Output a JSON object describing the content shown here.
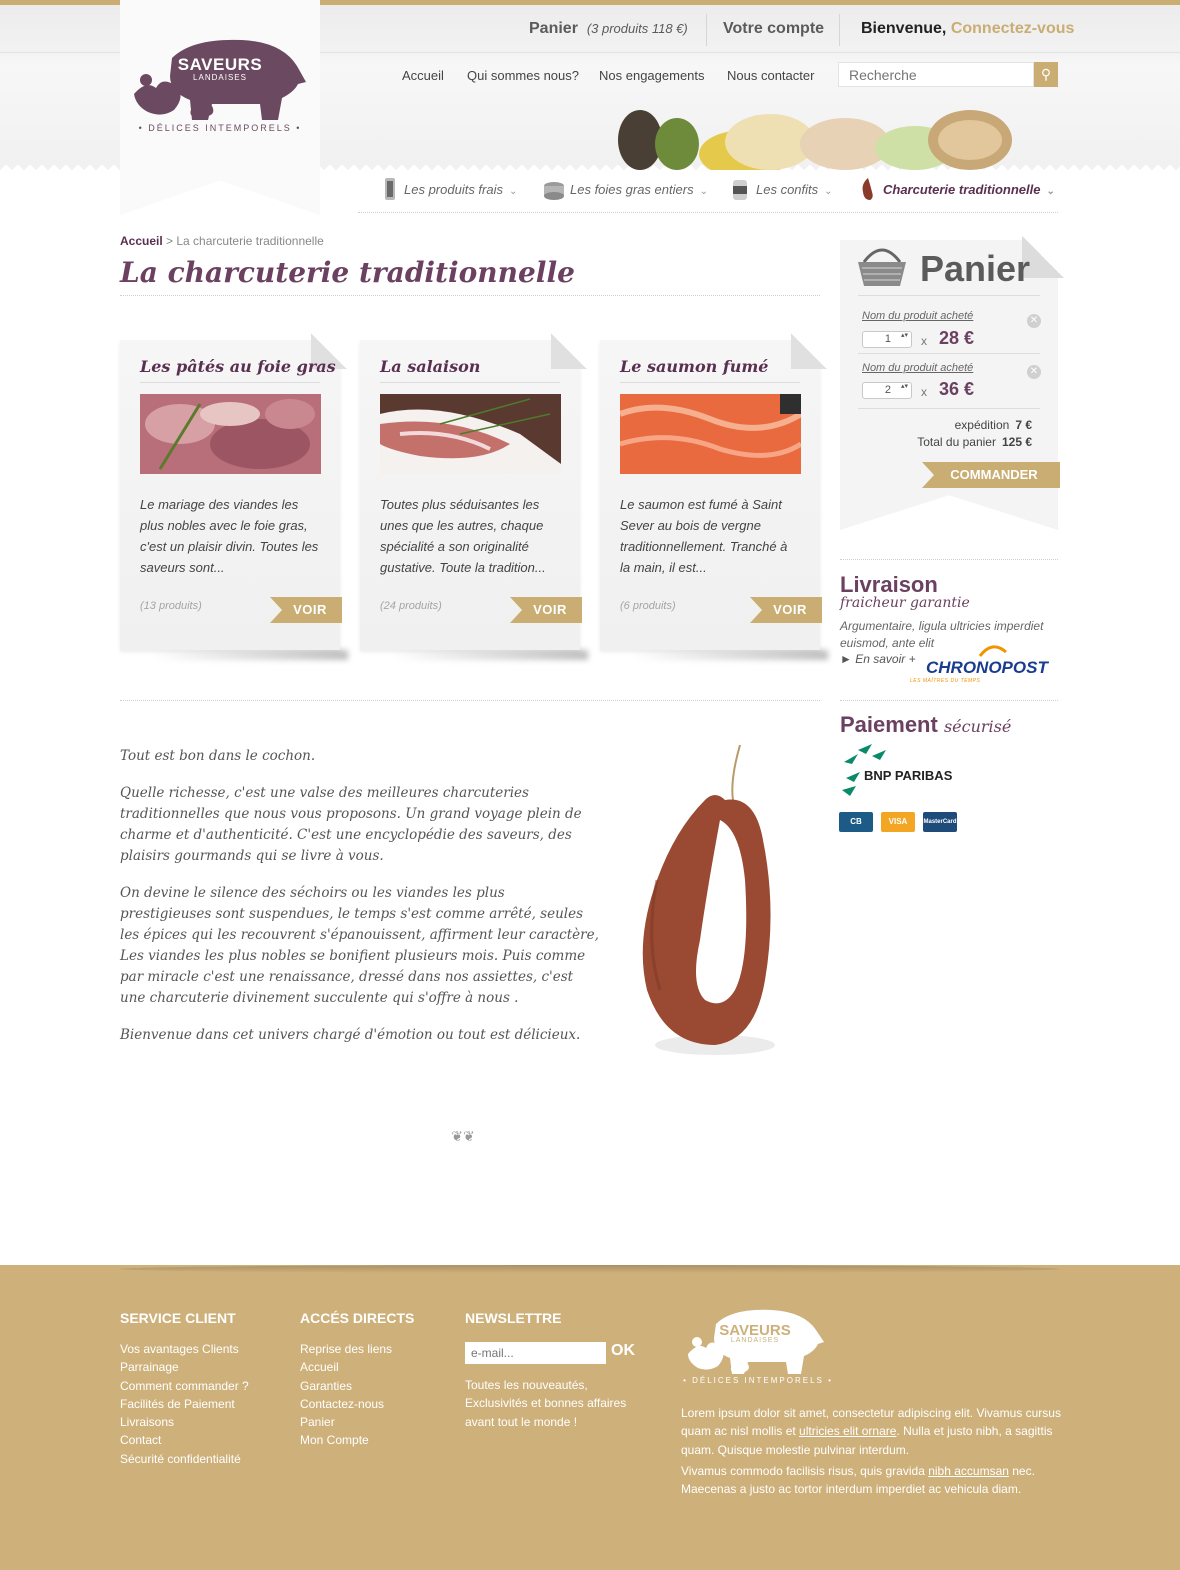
{
  "header": {
    "cart_label": "Panier",
    "cart_info": "(3 produits 118 €)",
    "account": "Votre compte",
    "welcome": "Bienvenue,",
    "connect": "Connectez-vous",
    "logo_main": "SAVEURS",
    "logo_sub": "LANDAISES",
    "logo_tagline": "• DÉLICES INTEMPORELS •",
    "nav": [
      "Accueil",
      "Qui sommes nous?",
      "Nos engagements",
      "Nous contacter"
    ],
    "search_placeholder": "Recherche",
    "categories": [
      {
        "label": "Les produits frais",
        "icon": "jar-icon"
      },
      {
        "label": "Les foies gras entiers",
        "icon": "tin-icon"
      },
      {
        "label": "Les confits",
        "icon": "can-icon"
      },
      {
        "label": "Charcuterie traditionnelle",
        "icon": "sausage-icon"
      }
    ]
  },
  "breadcrumb": {
    "home": "Accueil",
    "sep": " > ",
    "current": "La charcuterie traditionnelle"
  },
  "page_title": "La charcuterie traditionnelle",
  "cards": [
    {
      "title": "Les pâtés au foie gras",
      "text": "Le mariage des viandes les plus nobles avec le foie gras, c'est un plaisir divin. Toutes les saveurs sont...",
      "count": "(13 produits)",
      "button": "VOIR"
    },
    {
      "title": "La salaison",
      "text": "Toutes plus séduisantes les unes que les autres, chaque spécialité a son originalité gustative. Toute la tradition...",
      "count": "(24 produits)",
      "button": "VOIR"
    },
    {
      "title": "Le saumon fumé",
      "text": "Le saumon est fumé à Saint Sever au bois de vergne traditionnellement. Tranché à la main, il est...",
      "count": "(6 produits)",
      "button": "VOIR"
    }
  ],
  "intro": [
    "Tout est bon dans le cochon.",
    "Quelle richesse, c'est une valse des meilleures charcuteries traditionnelles que nous vous proposons. Un grand voyage plein de charme et d'authenticité. C'est une encyclopédie des saveurs, des plaisirs gourmands qui se livre à vous.",
    "On devine le silence des séchoirs ou les viandes les plus prestigieuses sont suspendues, le temps s'est comme arrêté, seules les épices qui les recouvrent s'épanouissent, affirment leur caractère, Les viandes les plus nobles se bonifient plusieurs mois. Puis comme par miracle c'est une renaissance, dressé dans nos assiettes, c'est une charcuterie divinement succulente qui s'offre à nous .",
    "Bienvenue dans cet univers chargé d'émotion ou tout est délicieux."
  ],
  "cart": {
    "title": "Panier",
    "items": [
      {
        "name": "Nom du produit acheté",
        "qty": "1",
        "x": "x",
        "price": "28 €"
      },
      {
        "name": "Nom du produit acheté",
        "qty": "2",
        "x": "x",
        "price": "36 €"
      }
    ],
    "shipping_label": "expédition",
    "shipping_value": "7 €",
    "total_label": "Total du panier",
    "total_value": "125 €",
    "button": "COMMANDER"
  },
  "delivery": {
    "title": "Livraison",
    "subtitle": "fraicheur garantie",
    "text": "Argumentaire, ligula ultricies imperdiet euismod, ante elit",
    "link": "► En savoir +",
    "brand": "CHRONOPOST",
    "brand_tag": "LES MAÎTRES DU TEMPS"
  },
  "payment": {
    "title": "Paiement",
    "subtitle": "sécurisé",
    "bank": "BNP PARIBAS",
    "cards": [
      "CB",
      "VISA",
      "MasterCard"
    ]
  },
  "footer": {
    "service": {
      "title": "SERVICE CLIENT",
      "items": [
        "Vos avantages Clients",
        "Parrainage",
        "Comment commander ?",
        "Facilités de Paiement",
        "Livraisons",
        "Contact",
        "Sécurité confidentialité"
      ]
    },
    "access": {
      "title": "ACCÉS DIRECTS",
      "items": [
        "Reprise des liens",
        "Accueil",
        "Garanties",
        "Contactez-nous",
        "Panier",
        "Mon Compte"
      ]
    },
    "newsletter": {
      "title": "NEWSLETTRE",
      "placeholder": "e-mail...",
      "ok": "OK",
      "text": "Toutes les nouveautés, Exclusivités et bonnes affaires avant tout le monde !"
    },
    "logo_main": "SAVEURS",
    "logo_sub": "LANDAISES",
    "logo_tagline": "• DÉLICES INTEMPORELS •",
    "lorem1_a": "Lorem ipsum dolor sit amet, consectetur adipiscing elit. Vivamus cursus quam ac nisl mollis et ",
    "lorem1_link": "ultricies elit ornare",
    "lorem1_b": ". Nulla et justo nibh, a sagittis quam. Quisque molestie pulvinar interdum.",
    "lorem2_a": "Vivamus commodo facilisis risus, quis gravida ",
    "lorem2_link": "nibh accumsan",
    "lorem2_b": " nec. Maecenas a justo ac tortor interdum imperdiet ac vehicula diam."
  },
  "colors": {
    "accent": "#c9ad73",
    "brand": "#6b4060",
    "footer": "#ceb07b"
  }
}
